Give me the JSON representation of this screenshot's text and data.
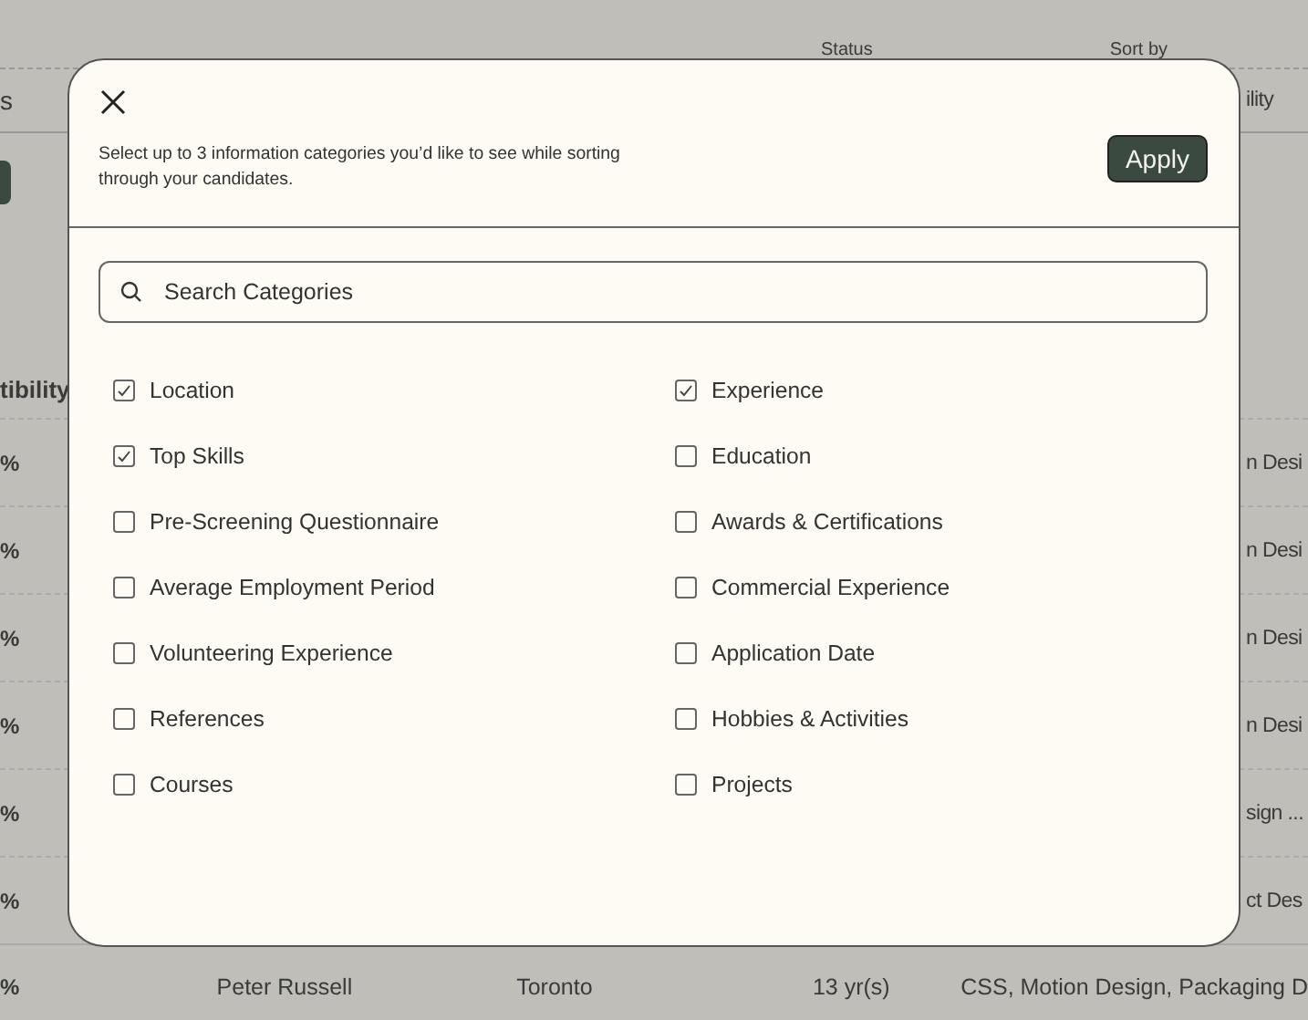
{
  "background": {
    "filters": [
      {
        "label": "Status"
      },
      {
        "label": "Sort by"
      }
    ],
    "header": {
      "left": "s",
      "right": "ility"
    },
    "column_heading": "tibility",
    "rows": [
      {
        "left": "%",
        "right": "n Desi"
      },
      {
        "left": "%",
        "right": "n Desi"
      },
      {
        "left": "%",
        "right": "n Desi"
      },
      {
        "left": "%",
        "right": "n Desi"
      },
      {
        "left": "%",
        "right": "sign ..."
      },
      {
        "left": "%",
        "right": "ct Des"
      }
    ],
    "last_row": [
      "%",
      "Peter Russell",
      "Toronto",
      "13 yr(s)",
      "CSS, Motion Design, Packaging D"
    ]
  },
  "dialog": {
    "description": "Select up to 3 information categories you’d like to see while sorting through your candidates.",
    "apply_button": "Apply",
    "search": {
      "placeholder": "Search Categories"
    },
    "categories": [
      {
        "label": "Location",
        "checked": true
      },
      {
        "label": "Experience",
        "checked": true
      },
      {
        "label": "Top Skills",
        "checked": true
      },
      {
        "label": "Education",
        "checked": false
      },
      {
        "label": "Pre-Screening Questionnaire",
        "checked": false
      },
      {
        "label": "Awards & Certifications",
        "checked": false
      },
      {
        "label": "Average Employment Period",
        "checked": false
      },
      {
        "label": "Commercial Experience",
        "checked": false
      },
      {
        "label": "Volunteering Experience",
        "checked": false
      },
      {
        "label": "Application Date",
        "checked": false
      },
      {
        "label": "References",
        "checked": false
      },
      {
        "label": "Hobbies & Activities",
        "checked": false
      },
      {
        "label": "Courses",
        "checked": false
      },
      {
        "label": "Projects",
        "checked": false
      }
    ]
  }
}
